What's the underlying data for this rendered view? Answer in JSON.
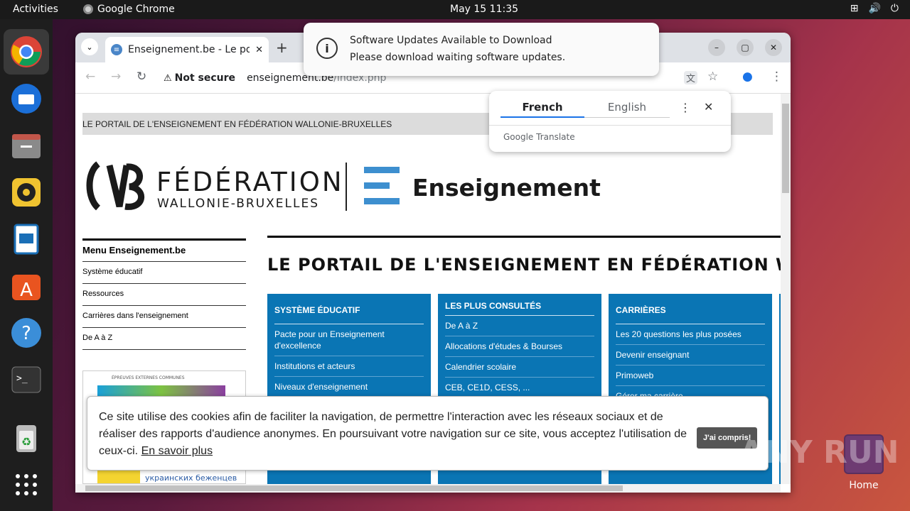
{
  "topbar": {
    "activities": "Activities",
    "app_name": "Google Chrome",
    "clock": "May 15  11:35"
  },
  "dock": {
    "items": [
      "chrome",
      "thunderbird",
      "files",
      "rhythmbox",
      "libreoffice-writer",
      "app-center",
      "help",
      "terminal",
      "trash",
      "show-apps"
    ]
  },
  "desktop": {
    "home_label": "Home"
  },
  "notification": {
    "title": "Software Updates Available to Download",
    "body": "Please download waiting software updates."
  },
  "browser": {
    "tab_title": "Enseignement.be - Le portail",
    "not_secure": "Not secure",
    "url_host": "enseignement.be",
    "url_path": "/index.php"
  },
  "translate": {
    "source_lang": "French",
    "target_lang": "English",
    "brand": "Google Translate"
  },
  "page": {
    "banner": "LE PORTAIL DE L'ENSEIGNEMENT EN FÉDÉRATION WALLONIE-BRUXELLES",
    "logo_line1": "FÉDÉRATION",
    "logo_line2": "WALLONIE-BRUXELLES",
    "logo_ens": "Enseignement",
    "menu_title": "Menu Enseignement.be",
    "menu_items": [
      "Système éducatif",
      "Ressources",
      "Carrières dans l'enseignement",
      "De A à Z"
    ],
    "promo_text": "ÉPREUVES EXTERNES COMMUNES",
    "promo_ru": "украинских беженцев",
    "title": "LE PORTAIL DE L'ENSEIGNEMENT EN FÉDÉRATION WALL",
    "columns": [
      {
        "heading": "SYSTÈME ÉDUCATIF",
        "items": [
          "Pacte pour un Enseignement d'excellence",
          "Institutions et acteurs",
          "Niveaux d'enseignement"
        ]
      },
      {
        "heading": "LES PLUS CONSULTÉS",
        "items": [
          "De A à Z",
          "Allocations d'études & Bourses",
          "Calendrier scolaire",
          "CEB, CE1D, CESS, ..."
        ]
      },
      {
        "heading": "CARRIÈRES",
        "items": [
          "Les 20 questions les plus posées",
          "Devenir enseignant",
          "Primoweb",
          "Gérer ma carrière"
        ]
      }
    ]
  },
  "cookie": {
    "text": "Ce site utilise des cookies afin de faciliter la navigation, de permettre l'interaction avec les réseaux sociaux et de réaliser des rapports d'audience anonymes. En poursuivant votre navigation sur ce site, vous acceptez l'utilisation de ceux-ci.",
    "more": "En savoir plus",
    "accept": "J'ai compris!"
  },
  "watermark": "ANY RUN"
}
